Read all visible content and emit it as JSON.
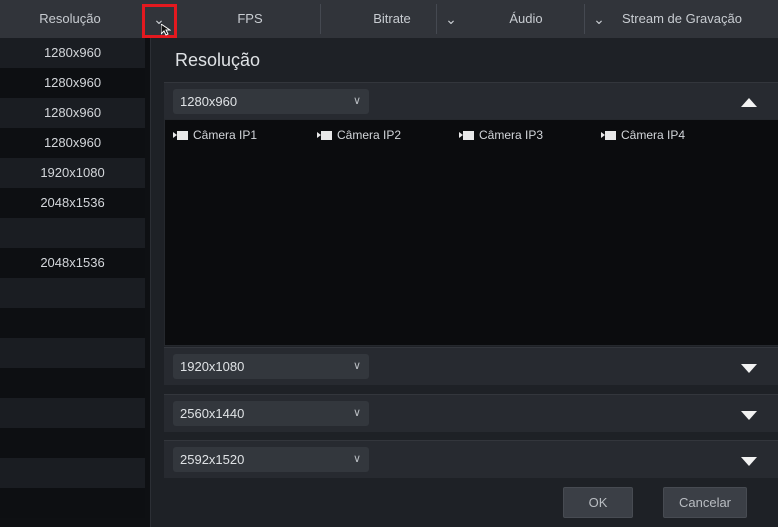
{
  "header": {
    "columns": [
      {
        "label": "Resolução"
      },
      {
        "label": "FPS"
      },
      {
        "label": "Bitrate"
      },
      {
        "label": "Áudio"
      },
      {
        "label": "Stream de Gravação"
      }
    ],
    "chevron_icon": "chevron-down-icon",
    "highlight_color": "#e3191f"
  },
  "left_rows": [
    {
      "value": "1280x960"
    },
    {
      "value": "1280x960"
    },
    {
      "value": "1280x960"
    },
    {
      "value": "1280x960"
    },
    {
      "value": "1920x1080"
    },
    {
      "value": "2048x1536"
    },
    {
      "value": ""
    },
    {
      "value": "2048x1536"
    },
    {
      "value": ""
    },
    {
      "value": ""
    },
    {
      "value": ""
    },
    {
      "value": ""
    },
    {
      "value": ""
    },
    {
      "value": ""
    },
    {
      "value": ""
    },
    {
      "value": ""
    }
  ],
  "dialog": {
    "title": "Resolução",
    "groups": [
      {
        "value": "1280x960",
        "expanded": true,
        "cameras": [
          "Câmera IP1",
          "Câmera IP2",
          "Câmera IP3",
          "Câmera IP4"
        ]
      },
      {
        "value": "1920x1080",
        "expanded": false
      },
      {
        "value": "2560x1440",
        "expanded": false
      },
      {
        "value": "2592x1520",
        "expanded": false
      }
    ],
    "ok_label": "OK",
    "cancel_label": "Cancelar"
  }
}
